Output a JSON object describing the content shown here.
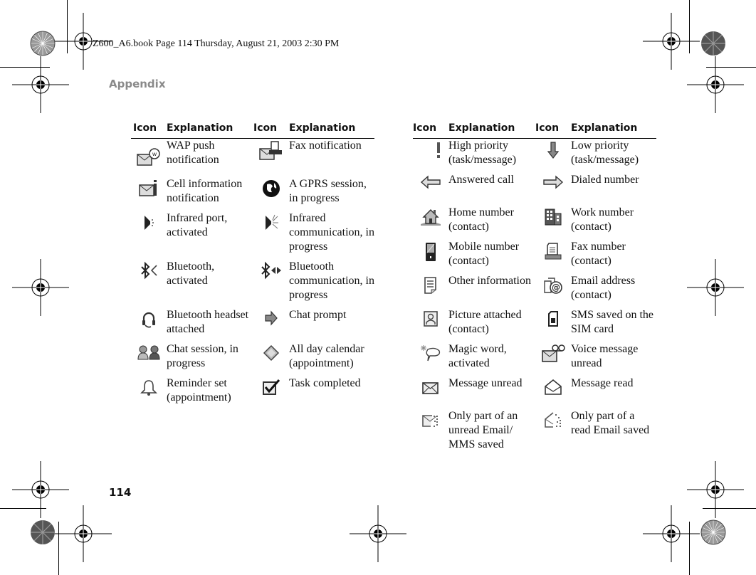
{
  "header": {
    "print_line": "Z600_A6.book  Page 114  Thursday, August 21, 2003  2:30 PM",
    "section": "Appendix"
  },
  "footer": {
    "page_number": "114"
  },
  "columns": {
    "icon": "Icon",
    "explanation": "Explanation"
  },
  "left_table": {
    "rows": [
      [
        {
          "icon": "wap-push-icon",
          "text": "WAP push notification"
        },
        {
          "icon": "fax-notification-icon",
          "text": "Fax notification"
        }
      ],
      [
        {
          "icon": "cell-info-icon",
          "text": "Cell information notification"
        },
        {
          "icon": "gprs-session-icon",
          "text": "A GPRS session, in progress"
        }
      ],
      [
        {
          "icon": "infrared-port-icon",
          "text": "Infrared port, activated"
        },
        {
          "icon": "infrared-communication-icon",
          "text": "Infrared communication, in progress"
        }
      ],
      [
        {
          "icon": "bluetooth-activated-icon",
          "text": "Bluetooth, activated"
        },
        {
          "icon": "bluetooth-communication-icon",
          "text": "Bluetooth communication, in progress"
        }
      ],
      [
        {
          "icon": "bluetooth-headset-icon",
          "text": "Bluetooth headset attached"
        },
        {
          "icon": "chat-prompt-icon",
          "text": "Chat prompt"
        }
      ],
      [
        {
          "icon": "chat-session-icon",
          "text": "Chat session, in progress"
        },
        {
          "icon": "all-day-calendar-icon",
          "text": "All day calendar (appointment)"
        }
      ],
      [
        {
          "icon": "reminder-bell-icon",
          "text": "Reminder set (appointment)"
        },
        {
          "icon": "task-completed-icon",
          "text": "Task completed"
        }
      ]
    ]
  },
  "right_table": {
    "rows": [
      [
        {
          "icon": "high-priority-icon",
          "text": "High priority (task/message)"
        },
        {
          "icon": "low-priority-icon",
          "text": "Low priority (task/message)"
        }
      ],
      [
        {
          "icon": "answered-call-icon",
          "text": "Answered call"
        },
        {
          "icon": "dialed-number-icon",
          "text": "Dialed number"
        }
      ],
      [
        {
          "icon": "home-number-icon",
          "text": "Home number (contact)"
        },
        {
          "icon": "work-number-icon",
          "text": "Work number (contact)"
        }
      ],
      [
        {
          "icon": "mobile-number-icon",
          "text": "Mobile number (contact)"
        },
        {
          "icon": "fax-number-icon",
          "text": "Fax number (contact)"
        }
      ],
      [
        {
          "icon": "other-information-icon",
          "text": "Other information"
        },
        {
          "icon": "email-address-icon",
          "text": "Email address (contact)"
        }
      ],
      [
        {
          "icon": "picture-attached-icon",
          "text": "Picture attached (contact)"
        },
        {
          "icon": "sim-card-sms-icon",
          "text": "SMS saved on the SIM card"
        }
      ],
      [
        {
          "icon": "magic-word-icon",
          "text": "Magic word, activated"
        },
        {
          "icon": "voice-message-icon",
          "text": "Voice message unread"
        }
      ],
      [
        {
          "icon": "message-unread-icon",
          "text": "Message unread"
        },
        {
          "icon": "message-read-icon",
          "text": "Message read"
        }
      ],
      [
        {
          "icon": "partial-unread-email-icon",
          "text": "Only part of an unread Email/ MMS saved"
        },
        {
          "icon": "partial-read-email-icon",
          "text": "Only part of a read Email saved"
        }
      ]
    ]
  },
  "colors": {
    "text": "#111111",
    "section_heading": "#8a8a8a",
    "icon_gray": "#555555"
  }
}
